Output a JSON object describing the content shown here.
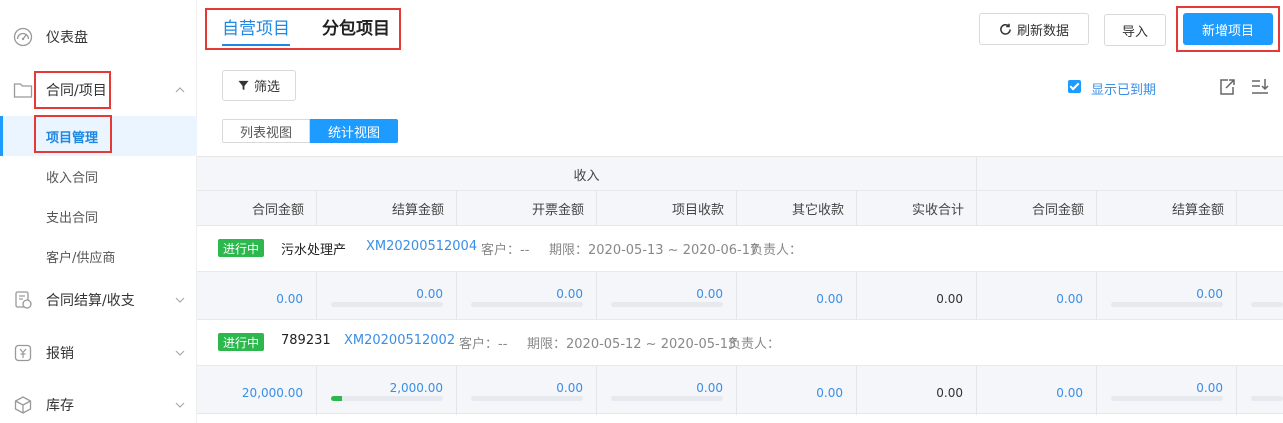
{
  "sidebar": {
    "dashboard": "仪表盘",
    "contracts": "合同/项目",
    "sub": [
      "项目管理",
      "收入合同",
      "支出合同",
      "客户/供应商"
    ],
    "settlement": "合同结算/收支",
    "expense": "报销",
    "inventory": "库存"
  },
  "tabs": {
    "self": "自营项目",
    "sub": "分包项目"
  },
  "toolbar": {
    "refresh": "刷新数据",
    "import": "导入",
    "new": "新增项目"
  },
  "filter": {
    "label": "筛选",
    "show_expired": "显示已到期"
  },
  "view": {
    "list": "列表视图",
    "stats": "统计视图"
  },
  "table": {
    "group_income": "收入",
    "columns": [
      "合同金额",
      "结算金额",
      "开票金额",
      "项目收款",
      "其它收款",
      "实收合计",
      "合同金额",
      "结算金额"
    ]
  },
  "projects": [
    {
      "status": "进行中",
      "name": "污水处理产",
      "code": "XM20200512004",
      "customer": "客户：--",
      "period": "期限：2020-05-13 ~ 2020-06-17",
      "owner": "负责人：",
      "values": [
        "0.00",
        "0.00",
        "0.00",
        "0.00",
        "0.00",
        "0.00",
        "0.00",
        "0.00"
      ],
      "progress": [
        0,
        0,
        0,
        0,
        0,
        0,
        0,
        0
      ]
    },
    {
      "status": "进行中",
      "name": "789231",
      "code": "XM20200512002",
      "customer": "客户：--",
      "period": "期限：2020-05-12 ~ 2020-05-13",
      "owner": "负责人：",
      "values": [
        "20,000.00",
        "2,000.00",
        "0.00",
        "0.00",
        "0.00",
        "0.00",
        "0.00",
        "0.00"
      ],
      "progress": [
        0,
        0.1,
        0,
        0,
        0,
        0,
        0,
        0
      ]
    }
  ],
  "colors": {
    "accent": "#1e9bff",
    "success": "#2db84d",
    "highlight": "#e53935"
  }
}
